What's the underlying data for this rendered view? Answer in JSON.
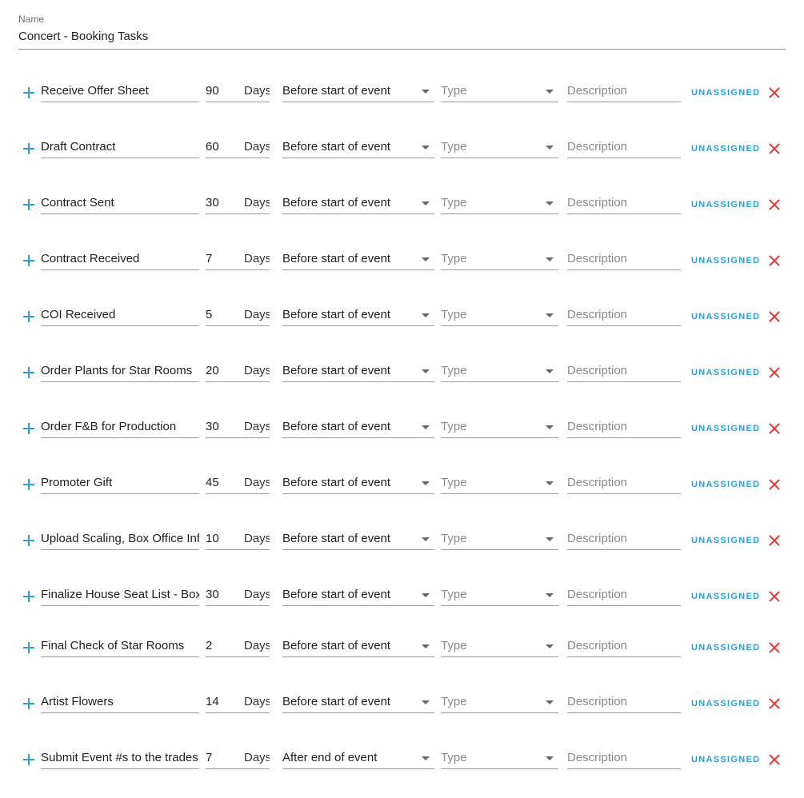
{
  "form": {
    "name_label": "Name",
    "name_value": "Concert - Booking Tasks"
  },
  "colors": {
    "accent": "#2a9fd6",
    "delete": "#e53935"
  },
  "icons": {
    "add": "plus-icon",
    "remove": "close-icon",
    "dropdown": "caret-down-icon"
  },
  "placeholders": {
    "type": "Type",
    "description": "Description"
  },
  "tasks": [
    {
      "name": "Receive Offer Sheet",
      "days": "90",
      "unit": "Days",
      "when": "Before start of event",
      "assign": "UNASSIGNED"
    },
    {
      "name": "Draft Contract",
      "days": "60",
      "unit": "Days",
      "when": "Before start of event",
      "assign": "UNASSIGNED"
    },
    {
      "name": "Contract Sent",
      "days": "30",
      "unit": "Days",
      "when": "Before start of event",
      "assign": "UNASSIGNED"
    },
    {
      "name": "Contract Received",
      "days": "7",
      "unit": "Days",
      "when": "Before start of event",
      "assign": "UNASSIGNED"
    },
    {
      "name": "COI Received",
      "days": "5",
      "unit": "Days",
      "when": "Before start of event",
      "assign": "UNASSIGNED"
    },
    {
      "name": "Order Plants for Star Rooms",
      "days": "20",
      "unit": "Days",
      "when": "Before start of event",
      "assign": "UNASSIGNED"
    },
    {
      "name": "Order F&B for Production",
      "days": "30",
      "unit": "Days",
      "when": "Before start of event",
      "assign": "UNASSIGNED"
    },
    {
      "name": "Promoter Gift",
      "days": "45",
      "unit": "Days",
      "when": "Before start of event",
      "assign": "UNASSIGNED"
    },
    {
      "name": "Upload Scaling, Box Office Info",
      "days": "10",
      "unit": "Days",
      "when": "Before start of event",
      "assign": "UNASSIGNED"
    },
    {
      "name": "Finalize House Seat List - Box Office",
      "days": "30",
      "unit": "Days",
      "when": "Before start of event",
      "assign": "UNASSIGNED"
    },
    {
      "name": "Final Check of Star Rooms",
      "days": "2",
      "unit": "Days",
      "when": "Before start of event",
      "assign": "UNASSIGNED"
    },
    {
      "name": "Artist Flowers",
      "days": "14",
      "unit": "Days",
      "when": "Before start of event",
      "assign": "UNASSIGNED"
    },
    {
      "name": "Submit Event #s to the trades",
      "days": "7",
      "unit": "Days",
      "when": "After end of event",
      "assign": "UNASSIGNED"
    }
  ]
}
